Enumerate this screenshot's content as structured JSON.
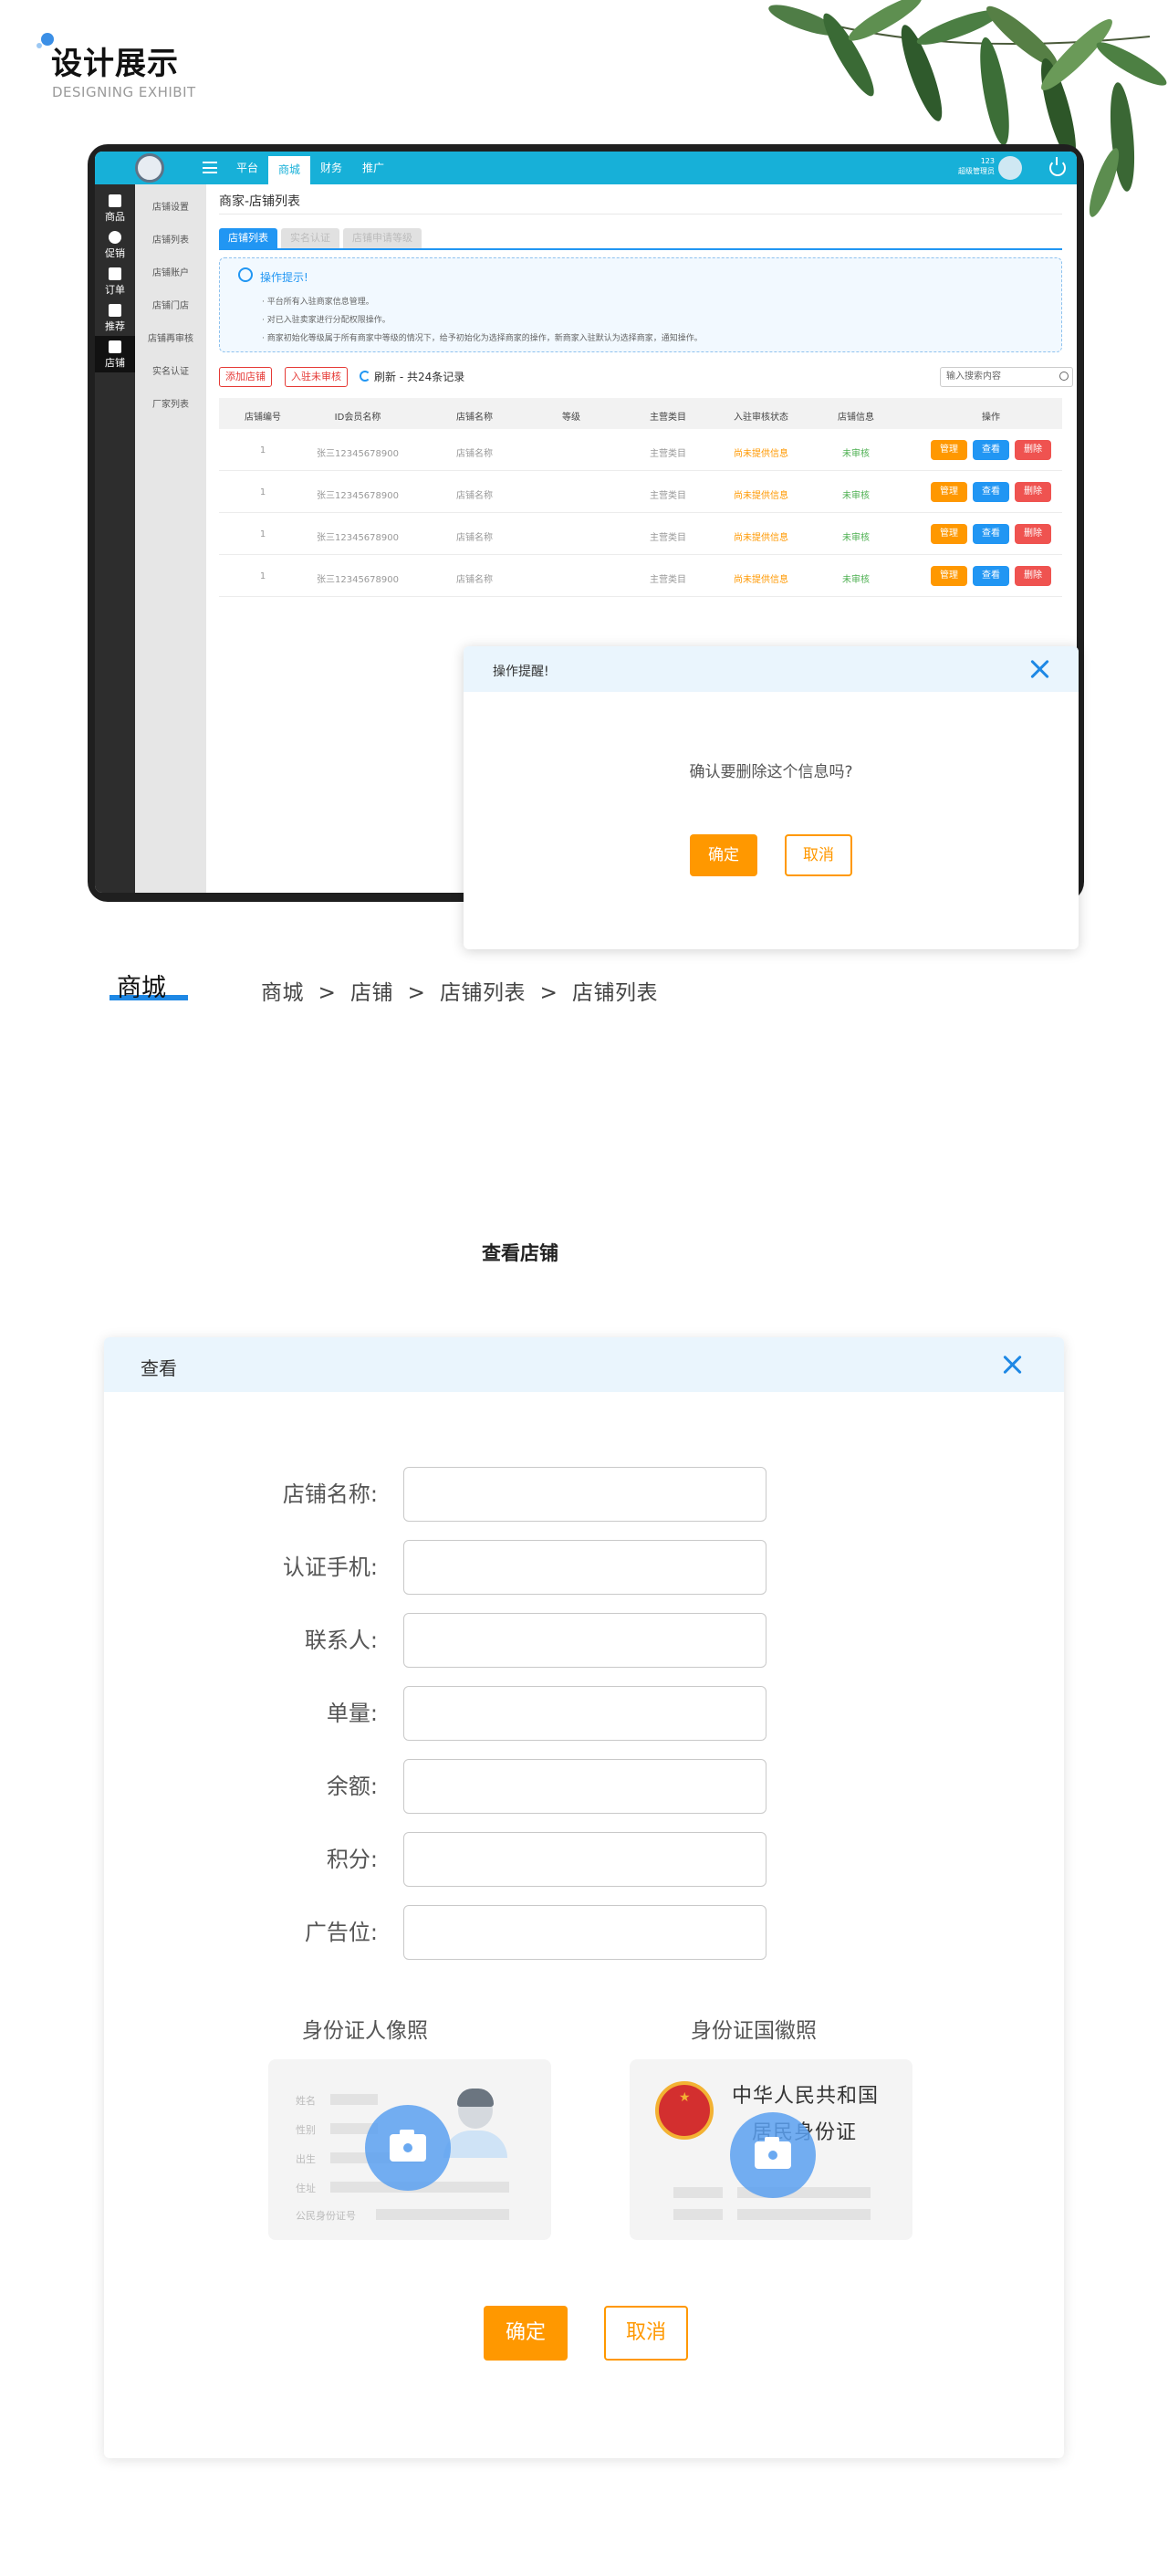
{
  "header": {
    "title": "设计展示",
    "subtitle": "DESIGNING EXHIBIT"
  },
  "app": {
    "topnav": [
      "平台",
      "商城",
      "财务",
      "推广"
    ],
    "active_nav": "商城",
    "user": {
      "line1": "123",
      "line2": "超级管理员"
    },
    "sidebar": [
      "商品",
      "促销",
      "订单",
      "推荐",
      "店铺"
    ],
    "active_sidebar": "店铺",
    "subnav": [
      "店铺设置",
      "店铺列表",
      "店铺账户",
      "店铺门店",
      "店铺再审核",
      "实名认证",
      "厂家列表"
    ],
    "page_title": "商家-店铺列表",
    "tabs": [
      "店铺列表",
      "实名认证",
      "店铺申请等级"
    ],
    "tips": {
      "title": "操作提示!",
      "lines": [
        "· 平台所有入驻商家信息管理。",
        "· 对已入驻卖家进行分配权限操作。",
        "· 商家初始化等级属于所有商家中等级的情况下，给予初始化为选择商家的操作，新商家入驻默认为选择商家，通知操作。"
      ]
    },
    "toolbar": {
      "add_label": "添加店铺",
      "review_label": "入驻未审核",
      "refresh_text": "刷新 - 共24条记录",
      "search_placeholder": "输入搜索内容"
    },
    "table": {
      "headers": [
        "店铺编号",
        "ID会员名称",
        "店铺名称",
        "等级",
        "主营类目",
        "入驻审核状态",
        "店铺信息",
        "操作"
      ],
      "rows": [
        [
          "1",
          "张三12345678900",
          "店铺名称",
          "",
          "主营类目",
          "尚未提供信息",
          "未审核"
        ],
        [
          "1",
          "张三12345678900",
          "店铺名称",
          "",
          "主营类目",
          "尚未提供信息",
          "未审核"
        ],
        [
          "1",
          "张三12345678900",
          "店铺名称",
          "",
          "主营类目",
          "尚未提供信息",
          "未审核"
        ],
        [
          "1",
          "张三12345678900",
          "店铺名称",
          "",
          "主营类目",
          "尚未提供信息",
          "未审核"
        ]
      ],
      "actions": [
        "管理",
        "查看",
        "删除"
      ]
    }
  },
  "confirm_modal": {
    "title": "操作提醒!",
    "message": "确认要删除这个信息吗?",
    "ok": "确定",
    "cancel": "取消"
  },
  "breadcrumb": {
    "brand": "商城",
    "path": "商城  >  店铺  >  店铺列表  >  店铺列表"
  },
  "section_title": "查看店铺",
  "view_modal": {
    "title": "查看",
    "fields": [
      "店铺名称:",
      "认证手机:",
      "联系人:",
      "单量:",
      "余额:",
      "积分:",
      "广告位:"
    ],
    "id_front_label": "身份证人像照",
    "id_back_label": "身份证国徽照",
    "id_front_fields": [
      "姓名",
      "性别",
      "出生",
      "住址",
      "公民身份证号"
    ],
    "id_back_line1": "中华人民共和国",
    "id_back_line2": "居民身份证",
    "ok": "确定",
    "cancel": "取消"
  },
  "colors": {
    "accent_blue": "#2196f3",
    "topbar": "#17b0d8",
    "orange": "#ff9800",
    "red": "#ef5350",
    "green": "#4caf50"
  }
}
